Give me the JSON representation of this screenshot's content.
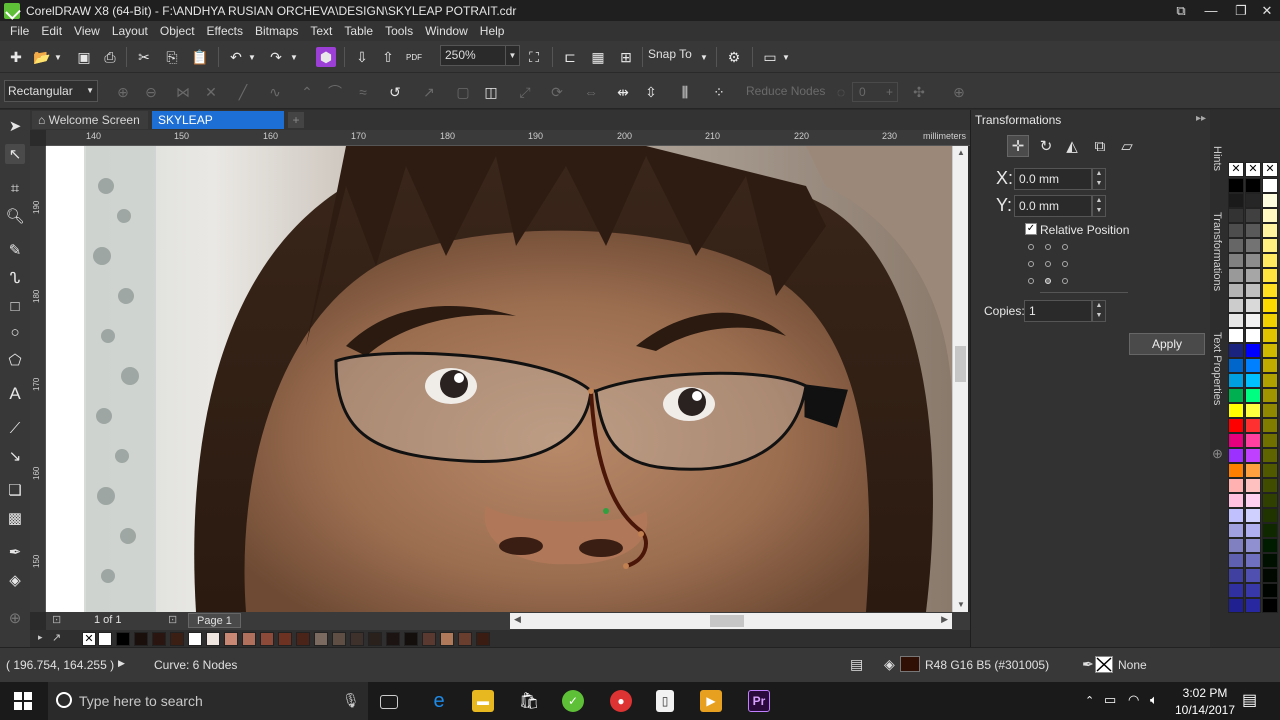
{
  "window": {
    "title": "CorelDRAW X8 (64-Bit) - F:\\ANDHYA RUSIAN ORCHEVA\\DESIGN\\SKYLEAP POTRAIT.cdr",
    "accent_color": "#5ec036"
  },
  "menu": [
    "File",
    "Edit",
    "View",
    "Layout",
    "Object",
    "Effects",
    "Bitmaps",
    "Text",
    "Table",
    "Tools",
    "Window",
    "Help"
  ],
  "standard_toolbar": {
    "zoom_level": "250%",
    "snap_to_label": "Snap To",
    "pdf_label": "PDF"
  },
  "property_bar": {
    "shape_mode": "Rectangular",
    "reduce_nodes_label": "Reduce Nodes",
    "node_count": "0"
  },
  "tabs": {
    "welcome": "Welcome Screen",
    "active_document": "SKYLEAP POTRAIT.cdr",
    "add_symbol": "+"
  },
  "ruler": {
    "horizontal_labels": [
      "140",
      "150",
      "160",
      "170",
      "180",
      "190",
      "200",
      "210",
      "220",
      "230"
    ],
    "vertical_labels": [
      "190",
      "180",
      "170",
      "160",
      "150"
    ],
    "unit": "millimeters"
  },
  "page_nav": {
    "count": "1 of 1",
    "page_tab": "Page 1"
  },
  "docker": {
    "title": "Transformations",
    "x_label": "X:",
    "x_value": "0.0 mm",
    "y_label": "Y:",
    "y_value": "0.0 mm",
    "relative_position_label": "Relative Position",
    "relative_position_checked": true,
    "copies_label": "Copies:",
    "copies_value": "1",
    "apply_label": "Apply",
    "side_tabs": [
      "Hints",
      "Transformations",
      "Text Properties"
    ]
  },
  "status": {
    "coordinates": "( 196.754, 164.255 )",
    "selection_info": "Curve: 6 Nodes",
    "fill_info": "R48 G16 B5 (#301005)",
    "fill_color": "#301005",
    "outline_info": "None"
  },
  "document_palette": [
    "#ffffff",
    "#000000",
    "#1a0f0a",
    "#2a1510",
    "#3b1e14",
    "#ffffff",
    "#efe6e0",
    "#c88874",
    "#b0705c",
    "#8e4a38",
    "#6e3222",
    "#4a2418",
    "#7a6a60",
    "#5e4e44",
    "#3e302a",
    "#2a201c",
    "#1c1412",
    "#140e0c",
    "#5a3a30",
    "#b07a5a",
    "#6a3e2e",
    "#3a1c12"
  ],
  "color_palette": {
    "col1": [
      "#000000",
      "#1a1a1a",
      "#333333",
      "#4d4d4d",
      "#666666",
      "#808080",
      "#999999",
      "#b3b3b3",
      "#cccccc",
      "#e6e6e6",
      "#ffffff",
      "#1a237e",
      "#0066cc",
      "#00a0e0",
      "#00b050",
      "#ffff00",
      "#ff0000",
      "#e6007e",
      "#9b30ff",
      "#ff8000",
      "#ffb0b0",
      "#ffc0e0",
      "#c0c0ff",
      "#a0a0e0",
      "#8080c0",
      "#6060b0",
      "#4040a0",
      "#3030a0",
      "#202090"
    ],
    "col2": [
      "#000000",
      "#262626",
      "#404040",
      "#595959",
      "#737373",
      "#8c8c8c",
      "#a6a6a6",
      "#bfbfbf",
      "#d9d9d9",
      "#f2f2f2",
      "#ffffff",
      "#0000ff",
      "#0080ff",
      "#00c0ff",
      "#00ff80",
      "#ffff40",
      "#ff3030",
      "#ff40a0",
      "#c040ff",
      "#ffa040",
      "#ffc0c0",
      "#ffd0f0",
      "#d0d0ff",
      "#b0b0f0",
      "#9090d0",
      "#7070c0",
      "#5050b0",
      "#3838a8",
      "#2828a0"
    ],
    "col3": [
      "#ffffff",
      "#fffde0",
      "#fff8c0",
      "#fff3a0",
      "#ffee80",
      "#ffe960",
      "#ffe440",
      "#ffdf20",
      "#ffda00",
      "#f0d000",
      "#e0c400",
      "#d0b800",
      "#c0ac00",
      "#b0a000",
      "#a09400",
      "#908800",
      "#807c00",
      "#707000",
      "#606400",
      "#505800",
      "#404c00",
      "#304000",
      "#203400",
      "#102800",
      "#001c00",
      "#001000",
      "#000800",
      "#000400",
      "#000000"
    ]
  },
  "taskbar": {
    "search_placeholder": "Type here to search",
    "time": "3:02 PM",
    "date": "10/14/2017"
  }
}
